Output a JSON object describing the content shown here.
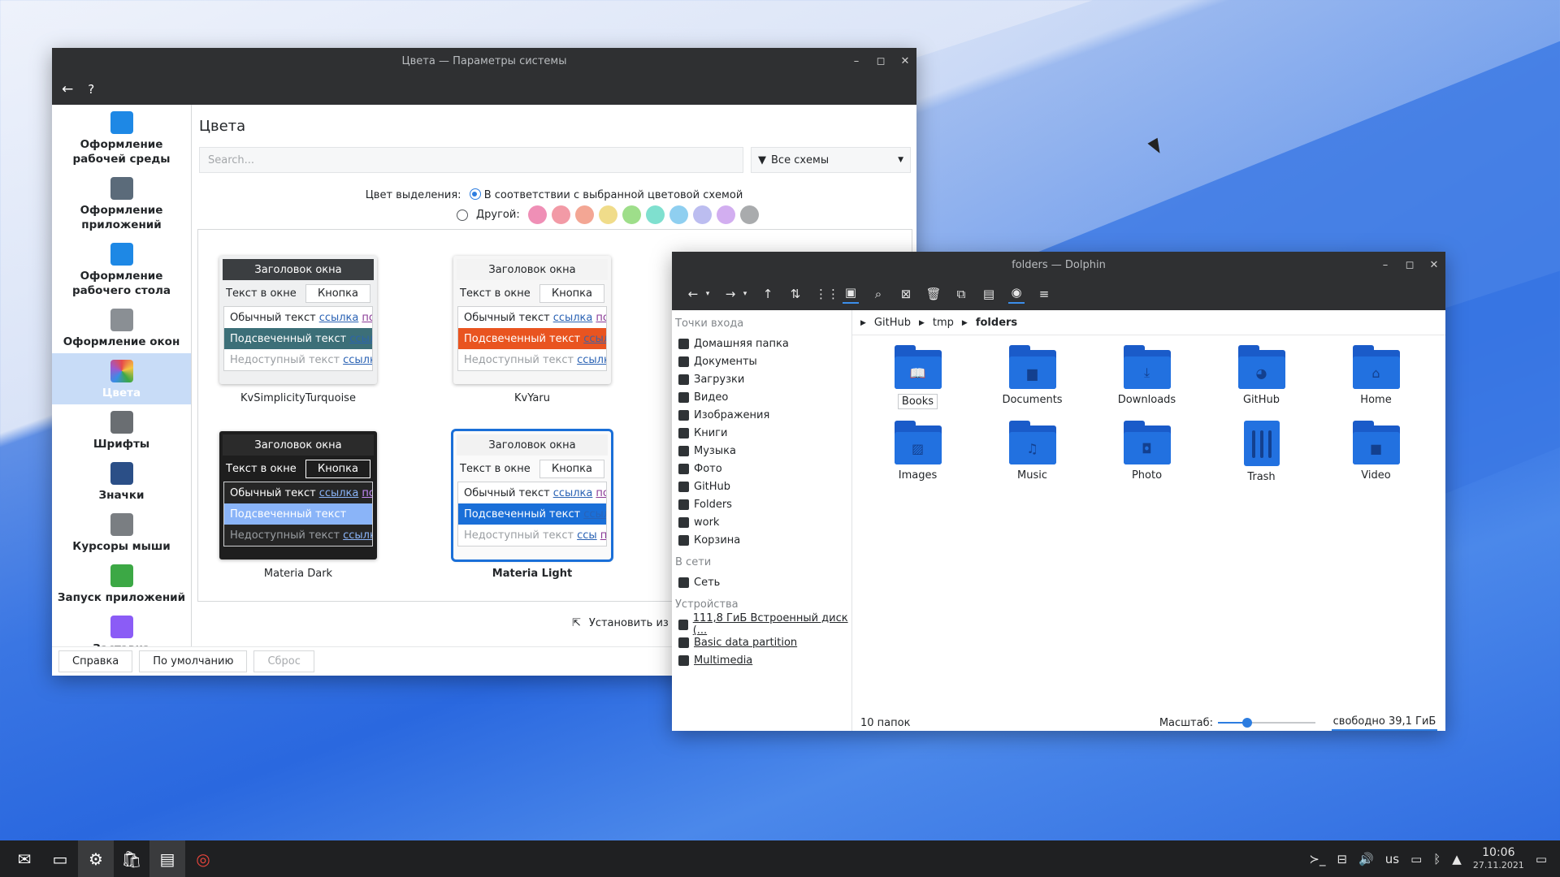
{
  "settings": {
    "title": "Цвета — Параметры системы",
    "back_icon": "←",
    "help_icon": "?",
    "sidebar": [
      {
        "label": "Оформление рабочей среды",
        "color": "#1e88e5"
      },
      {
        "label": "Оформление приложений",
        "color": "#5b6b7a"
      },
      {
        "label": "Оформление рабочего стола",
        "color": "#1e88e5"
      },
      {
        "label": "Оформление окон",
        "color": "#8a8f94"
      },
      {
        "label": "Цвета",
        "color": "#e64a4a"
      },
      {
        "label": "Шрифты",
        "color": "#6a6e72"
      },
      {
        "label": "Значки",
        "color": "#2b4f87"
      },
      {
        "label": "Курсоры мыши",
        "color": "#7a7e82"
      },
      {
        "label": "Запуск приложений",
        "color": "#3ca845"
      },
      {
        "label": "Заставка",
        "color": "#8b5cf6"
      }
    ],
    "heading": "Цвета",
    "search_placeholder": "Search...",
    "filter_label": "Все схемы",
    "accent_label": "Цвет выделения:",
    "accent_option1": "В соответствии с выбранной цветовой схемой",
    "accent_option2": "Другой:",
    "accent_swatches": [
      "#ef8fb6",
      "#f29aa6",
      "#f3a694",
      "#f0dc8a",
      "#9ede8a",
      "#7fe0cf",
      "#8fcff0",
      "#bcbdf0",
      "#d2aef0",
      "#a9abad"
    ],
    "schemes": [
      {
        "name": "KvSimplicityTurquoise",
        "title": "Заголовок окна",
        "text": "Текст в окне",
        "button": "Кнопка",
        "normal": "Обычный текст",
        "link": "ссылка",
        "visited": "посе...",
        "highlight": "Подсвеченный текст",
        "hl_link": "ссылка ...",
        "disabled": "Недоступный текст",
        "dis_link": "ссылка",
        "dis_visited": "по...",
        "bg_title": "#3b3e41",
        "fg_title": "#ffffff",
        "bg": "#f3f4f5",
        "fg": "#232629",
        "list_bg": "#ffffff",
        "hl_bg": "#3c6f78",
        "hl_fg": "#ffffff",
        "btn_bg": "#ffffff",
        "card_bg": "#eff0f1",
        "link_c": "#2a62b4",
        "visit_c": "#8a3a96",
        "sel": false,
        "bold": false
      },
      {
        "name": "KvYaru",
        "title": "Заголовок окна",
        "text": "Текст в окне",
        "button": "Кнопка",
        "normal": "Обычный текст",
        "link": "ссылка",
        "visited": "посе...",
        "highlight": "Подсвеченный текст",
        "hl_link": "ссылка",
        "disabled": "Недоступный текст",
        "dis_link": "ссылка",
        "dis_visited": "по...",
        "bg_title": "#f3f3f3",
        "fg_title": "#232629",
        "bg": "#f6f6f6",
        "fg": "#232629",
        "list_bg": "#ffffff",
        "hl_bg": "#e95420",
        "hl_fg": "#ffffff",
        "btn_bg": "#ffffff",
        "card_bg": "#f6f6f6",
        "link_c": "#2a62b4",
        "visit_c": "#8a3a96",
        "sel": false,
        "bold": false
      },
      {
        "name": "Materia Dark",
        "title": "Заголовок окна",
        "text": "Текст в окне",
        "button": "Кнопка",
        "normal": "Обычный текст",
        "link": "ссылка",
        "visited": "посе...",
        "highlight": "Подсвеченный текст",
        "hl_link": "ссылка ...",
        "disabled": "Недоступный текст",
        "dis_link": "ссылка",
        "dis_visited": "по...",
        "bg_title": "#2b2b2b",
        "fg_title": "#ffffff",
        "bg": "#1e1e1e",
        "fg": "#ffffff",
        "list_bg": "#262626",
        "hl_bg": "#8ab4f8",
        "hl_fg": "#ffffff",
        "btn_bg": "#1e1e1e",
        "card_bg": "#1e1e1e",
        "link_c": "#8ab4f8",
        "visit_c": "#c58af9",
        "sel": false,
        "bold": false
      },
      {
        "name": "Materia Light",
        "title": "Заголовок окна",
        "text": "Текст в окне",
        "button": "Кнопка",
        "normal": "Обычный текст",
        "link": "ссылка",
        "visited": "посе...",
        "highlight": "Подсвеченный текст",
        "hl_link": "ссылка ...",
        "disabled": "Недоступный текст",
        "dis_link": "ссы",
        "dis_visited": "п",
        "bg_title": "#f2f2f2",
        "fg_title": "#232629",
        "bg": "#fafafa",
        "fg": "#232629",
        "list_bg": "#ffffff",
        "hl_bg": "#1a6fd8",
        "hl_fg": "#ffffff",
        "btn_bg": "#ffffff",
        "card_bg": "#fafafa",
        "link_c": "#2a62b4",
        "visit_c": "#8a3a96",
        "sel": true,
        "bold": true
      }
    ],
    "install_label": "Установить из",
    "footer": {
      "help": "Справка",
      "defaults": "По умолчанию",
      "reset": "Сброс"
    }
  },
  "dolphin": {
    "title": "folders — Dolphin",
    "toolbar_icons": [
      "←",
      "▾",
      "→",
      "▾",
      "↑",
      "⇅",
      "⋮⋮",
      "▣",
      "⌕",
      "⊠",
      "🗑",
      "⧉",
      "▤",
      "◉",
      "≡"
    ],
    "places_header": "Точки входа",
    "places": [
      {
        "label": "Домашняя папка",
        "icon": "home-icon"
      },
      {
        "label": "Документы",
        "icon": "document-icon"
      },
      {
        "label": "Загрузки",
        "icon": "download-icon"
      },
      {
        "label": "Видео",
        "icon": "video-icon"
      },
      {
        "label": "Изображения",
        "icon": "image-icon"
      },
      {
        "label": "Книги",
        "icon": "book-icon"
      },
      {
        "label": "Музыка",
        "icon": "music-icon"
      },
      {
        "label": "Фото",
        "icon": "camera-icon"
      },
      {
        "label": "GitHub",
        "icon": "github-icon"
      },
      {
        "label": "Folders",
        "icon": "folder-icon"
      },
      {
        "label": "work",
        "icon": "folder-icon"
      },
      {
        "label": "Корзина",
        "icon": "trash-icon"
      }
    ],
    "network_header": "В сети",
    "network": [
      {
        "label": "Сеть",
        "icon": "network-icon"
      }
    ],
    "devices_header": "Устройства",
    "devices": [
      {
        "label": "111,8 ГиБ Встроенный диск (...",
        "icon": "disk-icon"
      },
      {
        "label": "Basic data partition",
        "icon": "disk-icon"
      },
      {
        "label": "Multimedia",
        "icon": "disk-icon"
      }
    ],
    "breadcrumbs": [
      "GitHub",
      "tmp",
      "folders"
    ],
    "items": [
      {
        "label": "Books",
        "glyph": "📖"
      },
      {
        "label": "Documents",
        "glyph": "▆"
      },
      {
        "label": "Downloads",
        "glyph": "⤓"
      },
      {
        "label": "GitHub",
        "glyph": "◕"
      },
      {
        "label": "Home",
        "glyph": "⌂"
      },
      {
        "label": "Images",
        "glyph": "▨"
      },
      {
        "label": "Music",
        "glyph": "♫"
      },
      {
        "label": "Photo",
        "glyph": "◘"
      },
      {
        "label": "Trash",
        "glyph": "trash"
      },
      {
        "label": "Video",
        "glyph": "■"
      }
    ],
    "status_count": "10 папок",
    "zoom_label": "Масштаб:",
    "zoom_level": 0.3,
    "free_space": "свободно 39,1 ГиБ"
  },
  "taskbar": {
    "apps": [
      "✉",
      "▭",
      "⚙",
      "🛍",
      "▤",
      "◎"
    ],
    "tray": [
      "≻_",
      "⊟",
      "🔊",
      "us",
      "▭",
      "ᛒ",
      "▲"
    ],
    "time": "10:06",
    "date": "27.11.2021",
    "desktop_icon": "▭"
  }
}
